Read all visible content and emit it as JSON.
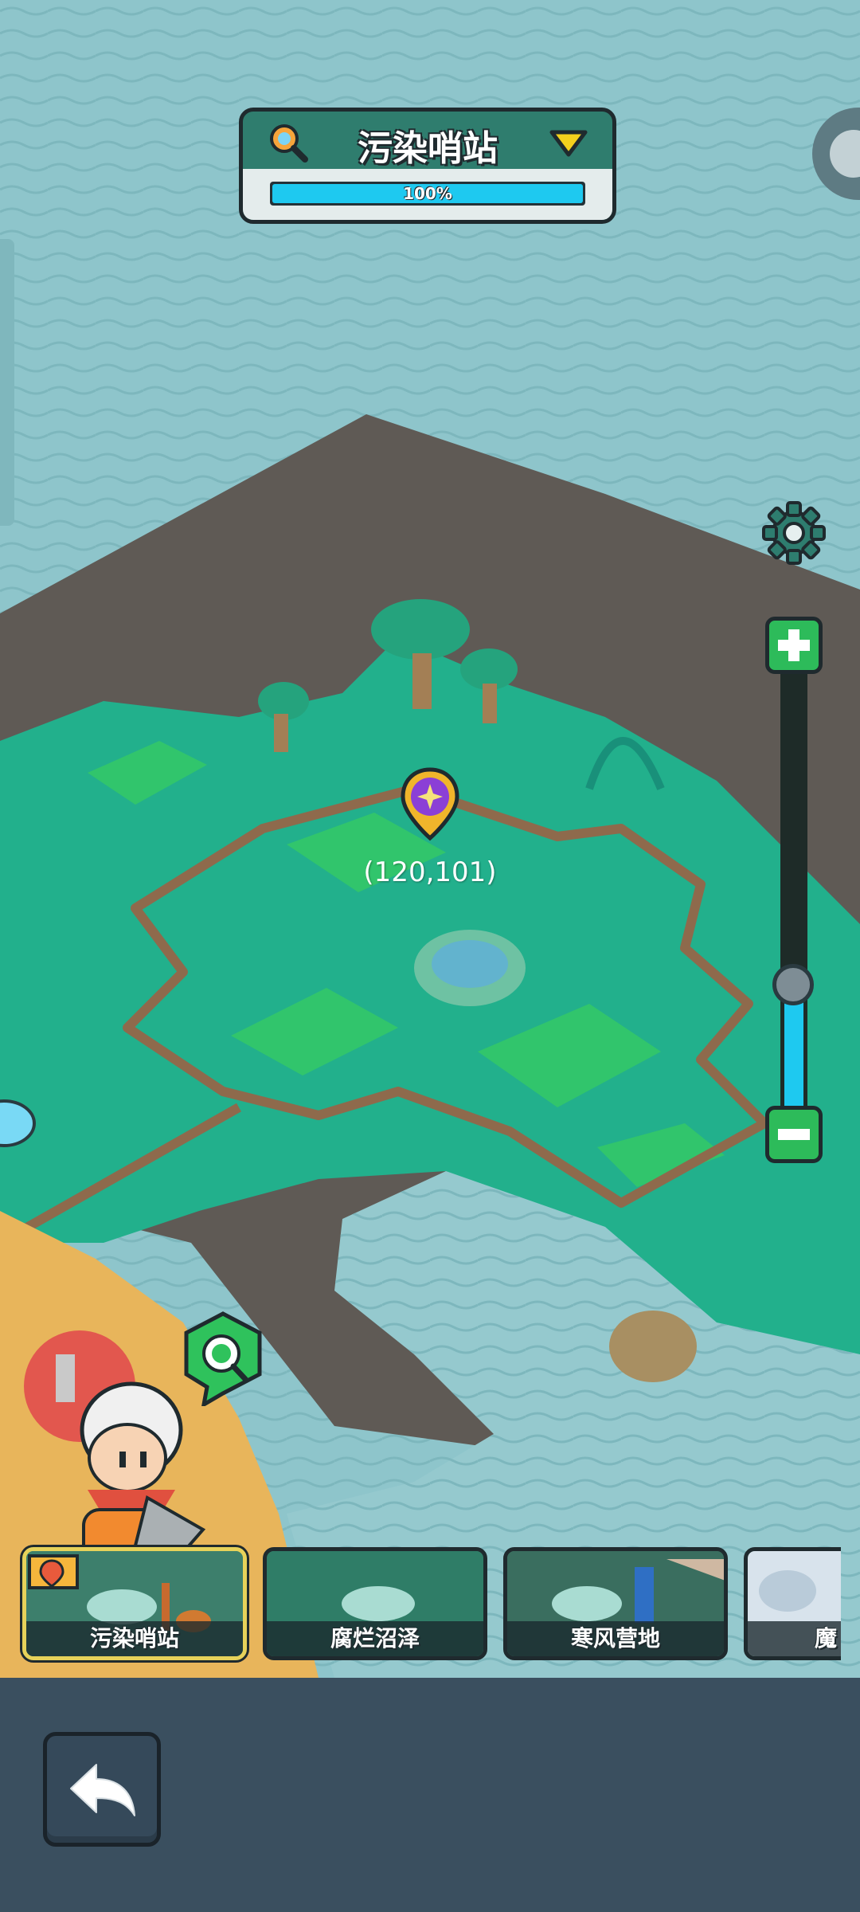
{
  "header": {
    "location_title": "污染哨站",
    "progress_text": "100%",
    "progress_fraction": 1.0
  },
  "map": {
    "coordinate_label": "(120,101)"
  },
  "zoom": {
    "level_fraction": 0.3
  },
  "locations": [
    {
      "label": "污染哨站",
      "selected": true
    },
    {
      "label": "腐烂沼泽",
      "selected": false
    },
    {
      "label": "寒风营地",
      "selected": false
    },
    {
      "label": "魔",
      "selected": false
    }
  ],
  "icons": {
    "search": "search-icon",
    "dropdown": "triangle-down-icon",
    "settings": "gear-icon",
    "zoom_in": "plus-icon",
    "zoom_out": "minus-icon",
    "marker": "star-map-pin-icon",
    "inspect": "magnifier-bubble-icon",
    "back": "back-arrow-icon",
    "pin": "map-pin-flag-icon"
  },
  "colors": {
    "water": "#8ec5cb",
    "grass": "#22b08c",
    "progress": "#1ec9f0",
    "zoom_buttons": "#2dbb5a",
    "bottom_panel": "#3a4f5f"
  }
}
